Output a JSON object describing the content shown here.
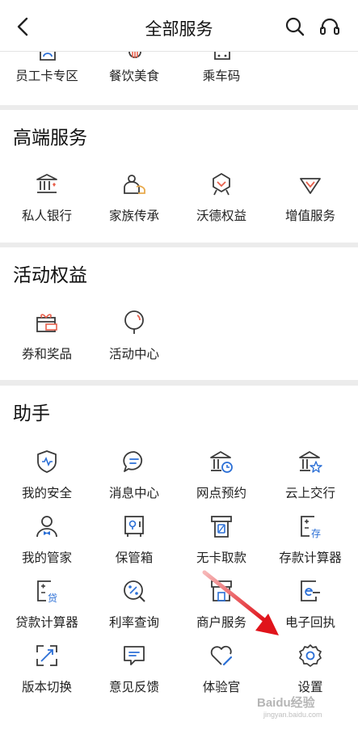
{
  "header": {
    "title": "全部服务"
  },
  "top_row": [
    {
      "label": "员工卡专区",
      "icon": "employee-card-icon"
    },
    {
      "label": "餐饮美食",
      "icon": "dining-icon"
    },
    {
      "label": "乘车码",
      "icon": "bus-code-icon"
    }
  ],
  "sections": [
    {
      "title": "高端服务",
      "items": [
        {
          "label": "私人银行",
          "icon": "private-bank-icon"
        },
        {
          "label": "家族传承",
          "icon": "family-heritage-icon"
        },
        {
          "label": "沃德权益",
          "icon": "wealth-rights-icon"
        },
        {
          "label": "增值服务",
          "icon": "value-added-icon"
        }
      ]
    },
    {
      "title": "活动权益",
      "items": [
        {
          "label": "券和奖品",
          "icon": "coupon-gift-icon"
        },
        {
          "label": "活动中心",
          "icon": "balloon-icon"
        }
      ]
    },
    {
      "title": "助手",
      "items": [
        {
          "label": "我的安全",
          "icon": "shield-icon"
        },
        {
          "label": "消息中心",
          "icon": "message-icon"
        },
        {
          "label": "网点预约",
          "icon": "branch-booking-icon"
        },
        {
          "label": "云上交行",
          "icon": "cloud-bank-icon"
        },
        {
          "label": "我的管家",
          "icon": "butler-icon"
        },
        {
          "label": "保管箱",
          "icon": "safe-box-icon"
        },
        {
          "label": "无卡取款",
          "icon": "cardless-withdraw-icon"
        },
        {
          "label": "存款计算器",
          "icon": "deposit-calculator-icon"
        },
        {
          "label": "贷款计算器",
          "icon": "loan-calculator-icon"
        },
        {
          "label": "利率查询",
          "icon": "interest-rate-icon"
        },
        {
          "label": "商户服务",
          "icon": "merchant-icon"
        },
        {
          "label": "电子回执",
          "icon": "e-receipt-icon"
        },
        {
          "label": "版本切换",
          "icon": "expand-arrows-icon"
        },
        {
          "label": "意见反馈",
          "icon": "feedback-icon"
        },
        {
          "label": "体验官",
          "icon": "heart-pen-icon"
        },
        {
          "label": "设置",
          "icon": "gear-icon"
        }
      ]
    }
  ],
  "colors": {
    "icon_stroke": "#3a3a3a",
    "accent": "#e8604c",
    "blue": "#2b6fd6",
    "arrow": "#e0141b"
  },
  "watermark": {
    "logo": "Baidu经验",
    "sub": "jingyan.baidu.com"
  }
}
